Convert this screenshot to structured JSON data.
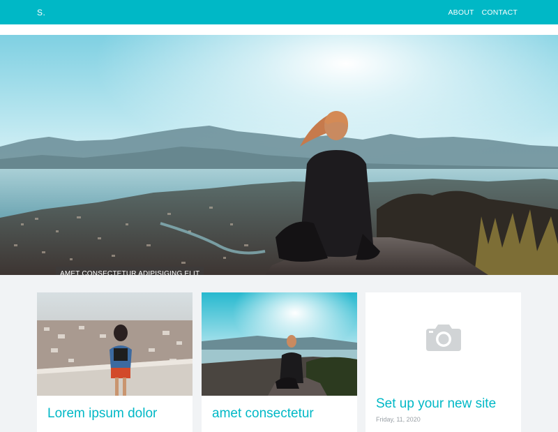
{
  "navbar": {
    "brand": "S.",
    "links": [
      "ABOUT",
      "CONTACT"
    ]
  },
  "hero": {
    "caption": "AMET CONSECTETUR ADIPISIGING ELIT",
    "slides": 3,
    "active_slide": 1,
    "image_alt": "woman-sitting-overlooking-lake"
  },
  "cards": [
    {
      "title": "Lorem ipsum dolor",
      "image": "girl-on-terrace-photo"
    },
    {
      "title": "amet consectetur",
      "image": "woman-sitting-overlooking-lake"
    },
    {
      "title": "Set up your new site",
      "meta": "Friday, 11, 2020",
      "image": "camera-icon"
    }
  ],
  "colors": {
    "accent": "#00b8c6",
    "page_bg": "#f1f3f5",
    "placeholder_icon": "#cfd3d6"
  }
}
